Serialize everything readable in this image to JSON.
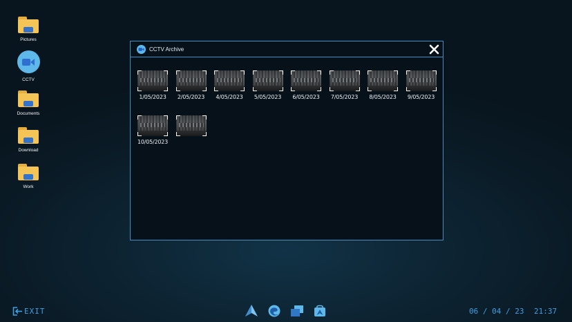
{
  "desktop": {
    "icons": [
      {
        "label": "Pictures",
        "icon": "folder-icon"
      },
      {
        "label": "CCTV",
        "icon": "video-camera-icon"
      },
      {
        "label": "Documents",
        "icon": "folder-icon"
      },
      {
        "label": "Download",
        "icon": "folder-icon"
      },
      {
        "label": "Work",
        "icon": "folder-icon"
      }
    ]
  },
  "window": {
    "title": "CCTV Archive",
    "title_icon": "video-camera-icon",
    "close_icon": "close-icon",
    "recordings": [
      {
        "date": "1/05/2023"
      },
      {
        "date": "2/05/2023"
      },
      {
        "date": "4/05/2023"
      },
      {
        "date": "5/05/2023"
      },
      {
        "date": "6/05/2023"
      },
      {
        "date": "7/05/2023"
      },
      {
        "date": "8/05/2023"
      },
      {
        "date": "9/05/2023"
      },
      {
        "date": "10/05/2023"
      }
    ]
  },
  "taskbar": {
    "exit_label": "EXIT",
    "exit_icon": "exit-icon",
    "apps": [
      {
        "name": "app-launcher-icon"
      },
      {
        "name": "browser-icon"
      },
      {
        "name": "windows-icon"
      },
      {
        "name": "store-icon"
      }
    ],
    "date": "06 / 04 / 23",
    "time": "21:37"
  },
  "colors": {
    "accent": "#3f9fe0",
    "border": "#3c8fc4",
    "folder": "#f5c457",
    "cctv": "#5fb8ea"
  }
}
